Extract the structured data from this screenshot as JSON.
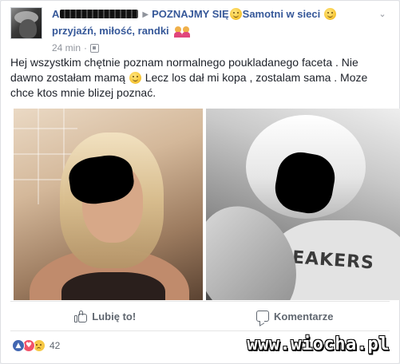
{
  "post": {
    "author_initial": "A",
    "group_name": "POZNAJMY SIĘ",
    "group_name_rest": "Samotni w sieci",
    "group_name_line2": "przyjaźń, miłość, randki",
    "time": "24 min",
    "text": "Hej wszystkim chętnie poznam normalnego poukladanego faceta . Nie dawno zostałam mamą",
    "text_rest": " Lecz los dał mi kopa , zostalam sama . Moze chce ktos mnie blizej poznać."
  },
  "photo_right_shirt_text": "EAKERS",
  "actions": {
    "like_label": "Lubię to!",
    "comment_label": "Komentarze"
  },
  "reactions": {
    "count": "42"
  },
  "watermark": "www.wiocha.pl",
  "colors": {
    "link": "#365899",
    "like_reaction": "#4267b2",
    "love_reaction": "#f25268",
    "sad_reaction": "#f7c844"
  }
}
